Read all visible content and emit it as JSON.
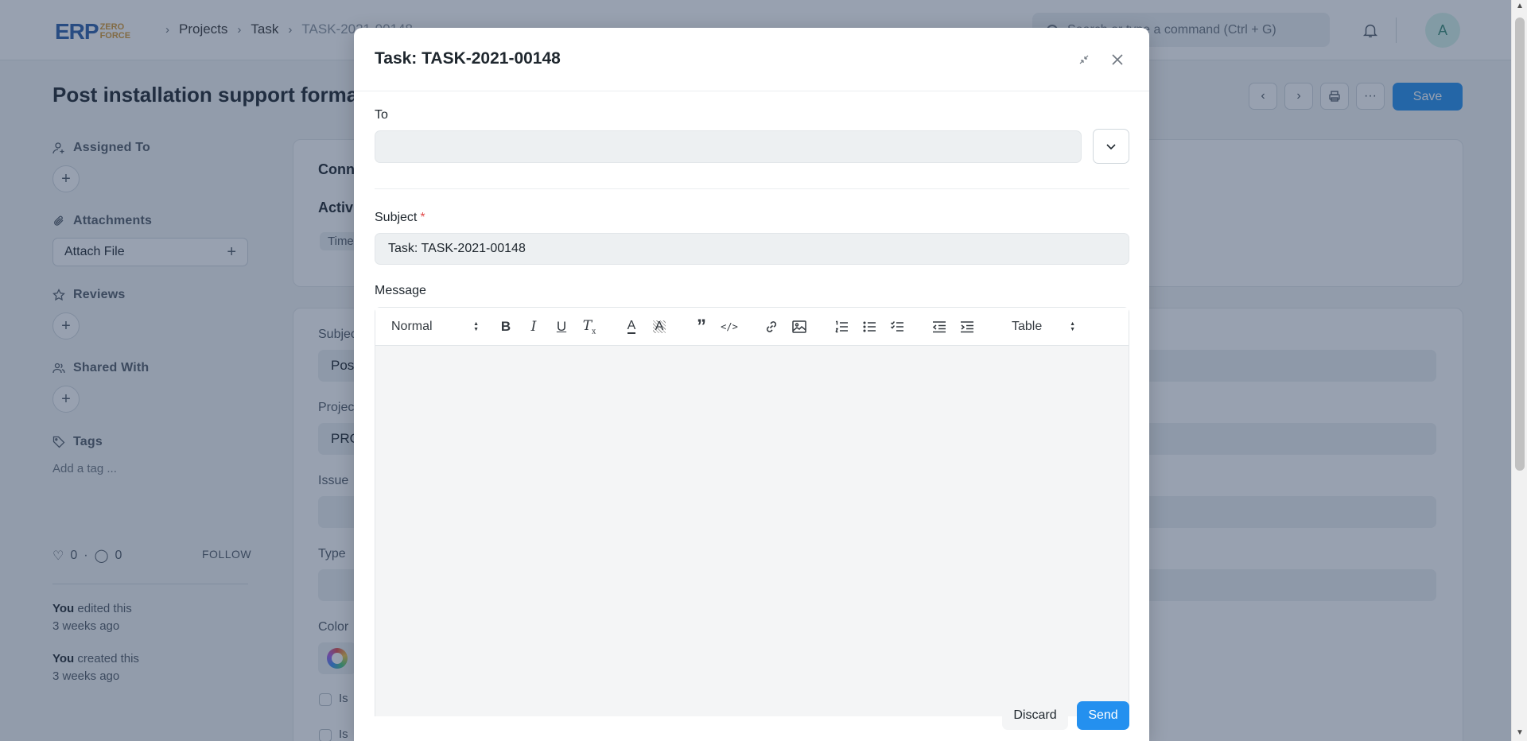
{
  "navbar": {
    "logo_main": "ERP",
    "logo_sub_1": "ZERO",
    "logo_sub_2": "FORCE",
    "breadcrumbs": [
      "Projects",
      "Task",
      "TASK-2021-00148"
    ],
    "search_placeholder": "Search or type a command (Ctrl + G)",
    "avatar_initial": "A"
  },
  "page": {
    "title": "Post installation support forma",
    "save_label": "Save"
  },
  "sidebar": {
    "assigned_to": "Assigned To",
    "attachments": "Attachments",
    "attach_file": "Attach File",
    "reviews": "Reviews",
    "shared_with": "Shared With",
    "tags": "Tags",
    "add_tag": "Add a tag ...",
    "likes": "0",
    "comments": "0",
    "follow": "FOLLOW",
    "activity": [
      {
        "who": "You",
        "what": "edited this",
        "when": "3 weeks ago"
      },
      {
        "who": "You",
        "what": "created this",
        "when": "3 weeks ago"
      }
    ]
  },
  "form": {
    "conn": "Conn",
    "activi": "Activi",
    "time": "Time",
    "subject_label": "Subjec",
    "subject_value": "Pos",
    "project_label": "Projec",
    "project_value": "PRO",
    "issue_label": "Issue",
    "type_label": "Type",
    "color_label": "Color",
    "check1": "Is",
    "check2": "Is"
  },
  "modal": {
    "title": "Task: TASK-2021-00148",
    "to_label": "To",
    "to_value": "",
    "subject_label": "Subject",
    "subject_required": "*",
    "subject_value": "Task: TASK-2021-00148",
    "message_label": "Message",
    "toolbar": {
      "format": "Normal",
      "table": "Table"
    },
    "discard_label": "Discard",
    "send_label": "Send"
  },
  "colors": {
    "primary": "#2490ef",
    "overlay": "#253858",
    "required": "#e24c4c"
  }
}
